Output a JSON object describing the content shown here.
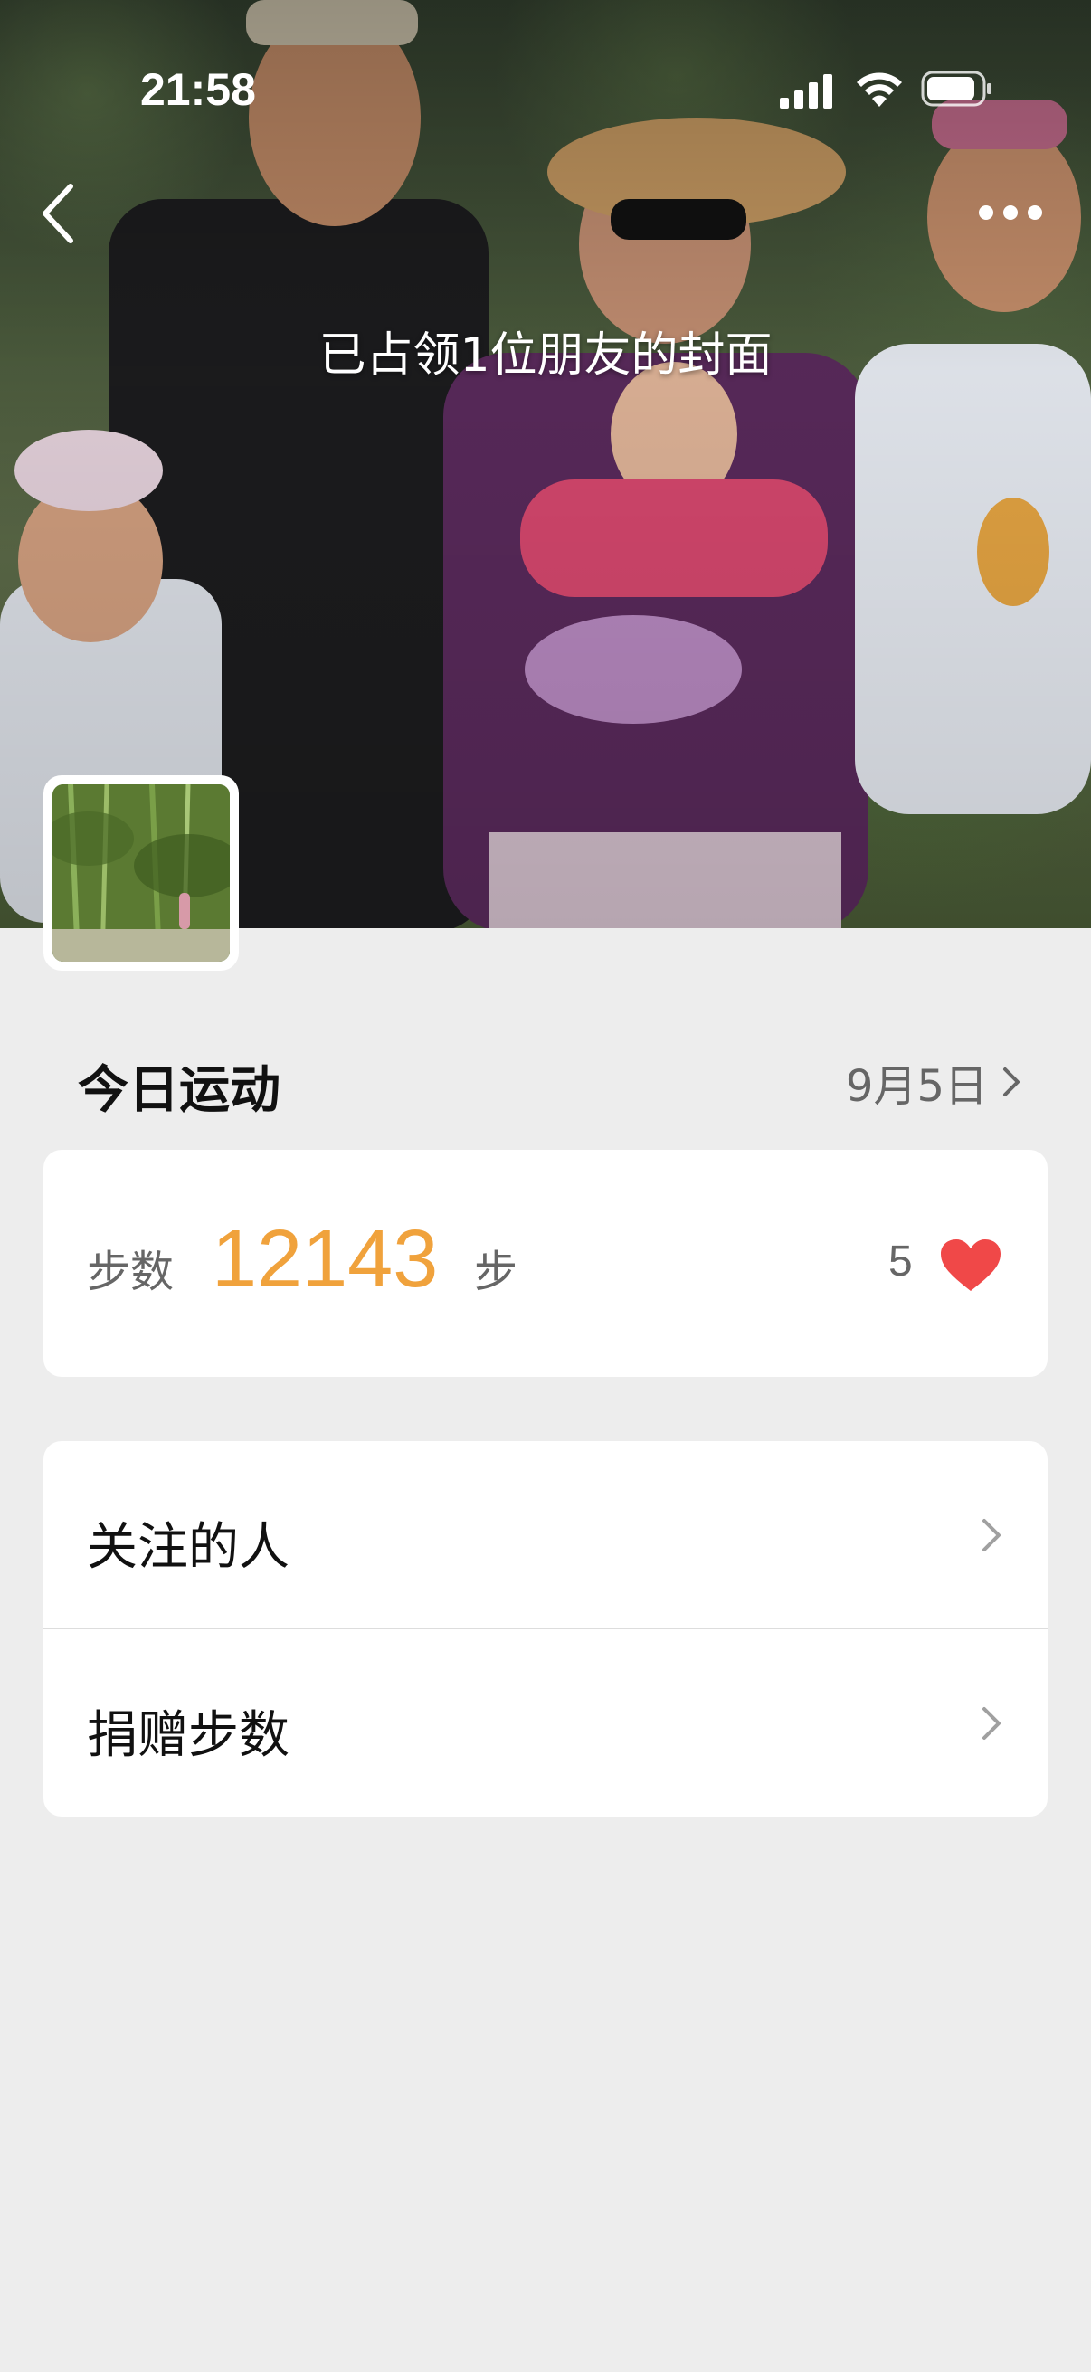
{
  "status_bar": {
    "time": "21:58"
  },
  "cover": {
    "caption": "已占领1位朋友的封面"
  },
  "today": {
    "title": "今日运动",
    "date": "9月5日"
  },
  "steps_card": {
    "label": "步数",
    "value": "12143",
    "unit": "步",
    "likes": "5"
  },
  "menu": {
    "items": [
      {
        "label": "关注的人"
      },
      {
        "label": "捐赠步数"
      }
    ]
  },
  "colors": {
    "accent_steps": "#f0a23c",
    "heart": "#f04848",
    "background": "#ededed"
  }
}
